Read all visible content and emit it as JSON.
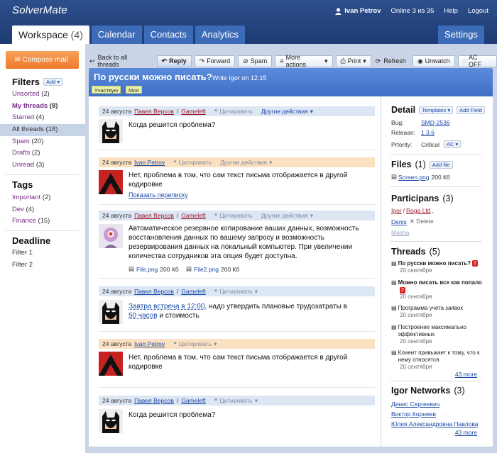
{
  "app": {
    "logo": "SolverMate"
  },
  "topbar": {
    "user": "Ivan Petrov",
    "online": "Online 3 из 35",
    "help": "Help",
    "logout": "Logout"
  },
  "tabs": [
    {
      "label": "Workspace",
      "count": "(4)"
    },
    {
      "label": "Calendar"
    },
    {
      "label": "Contacts"
    },
    {
      "label": "Analytics"
    }
  ],
  "settings": "Settings",
  "sidebar": {
    "compose": "Compose mail",
    "filters_title": "Filters",
    "add": "Add",
    "filters": [
      {
        "label": "Unsorted",
        "count": "(2)"
      },
      {
        "label": "My threads",
        "count": "(8)"
      },
      {
        "label": "Starred",
        "count": "(4)"
      },
      {
        "label": "All threads",
        "count": "(18)"
      },
      {
        "label": "Spam",
        "count": "(20)"
      },
      {
        "label": "Drafts",
        "count": "(2)"
      },
      {
        "label": "Unread",
        "count": "(3)"
      }
    ],
    "tags_title": "Tags",
    "tags": [
      {
        "label": "Important",
        "count": "(2)"
      },
      {
        "label": "Dev",
        "count": "(4)"
      },
      {
        "label": "Finance",
        "count": "(15)"
      }
    ],
    "deadline_title": "Deadline",
    "deadlines": [
      "Filter 1",
      "Filter 2"
    ]
  },
  "toolbar": {
    "back": "Back to all threads",
    "reply": "Reply",
    "forward": "Forward",
    "spam": "Spam",
    "more": "More actions",
    "print": "Print",
    "refresh": "Refresh",
    "unwatch": "Unwatch",
    "acoff": "AC OFF"
  },
  "subject": {
    "title": "По русски можно писать?",
    "write_prefix": "Write",
    "write_user": "Igor",
    "write_time": "on 12:15",
    "tags": [
      "Участвую",
      "Моя"
    ]
  },
  "messages": [
    {
      "date": "24 августа",
      "author": "Павел Версов",
      "company": "Gameleft",
      "quote": "Цитировать",
      "other": "Другие действия",
      "text": "Когда решится проблема?"
    },
    {
      "date": "24 августа",
      "author": "Ivan Petrov",
      "quote": "Цитировать",
      "other": "Другие действия",
      "text": "Нет, проблема в том, что сам текст письма отображается в другой кодировке",
      "link": "Показать переписку"
    },
    {
      "date": "24 августа",
      "author": "Павел Версов",
      "company": "Gameleft",
      "quote": "Цитировать",
      "other": "Другие действия",
      "text": "Автоматическое резервное копирование ваших данных, возможность восстановления данных по вашему запросу и возможность резервирования данных на локальный компьютер. При увеличении количества сотрудников эта опция будет доступна.",
      "attachments": [
        {
          "name": "File.png",
          "size": "200 Кб"
        },
        {
          "name": "File2.png",
          "size": "200 Кб"
        }
      ]
    },
    {
      "date": "24 августа",
      "author": "Павел Версов",
      "company": "Gameleft",
      "quote": "Цитировать",
      "text_link1": "Завтра встреча в 12:00",
      "text_mid": ", надо утвердить плановые трудозатраты в",
      "text_link2": "50 часов",
      "text_end": "и стоимость"
    },
    {
      "date": "24 августа",
      "author": "Ivan Petrov",
      "quote": "Цитировать",
      "text": "Нет, проблема в том, что сам текст письма отображается в другой кодировке"
    },
    {
      "date": "24 августа",
      "author": "Павел Версов",
      "company": "Gameleft",
      "quote": "Цитировать",
      "text": "Когда решится проблема?"
    }
  ],
  "detail": {
    "title": "Detail",
    "templates": "Templates",
    "add_field": "Add Field",
    "bug_label": "Bug:",
    "bug": "SMD-2536",
    "release_label": "Release:",
    "release": "1.3.6",
    "priority_label": "Prtority:",
    "priority": "Critical",
    "priority_ac": "AC"
  },
  "files": {
    "title": "Files",
    "count": "(1)",
    "add": "Add file",
    "file": "Screen.png",
    "size": "200 Кб"
  },
  "participants": {
    "title": "Participans",
    "count": "(3)",
    "p1": "Igor",
    "p1_company": "Roga Ltd",
    "p2": "Denis",
    "delete": "Delete",
    "p3": "Masha"
  },
  "threads": {
    "title": "Threads",
    "count": "(5)",
    "items": [
      {
        "title": "По русски можно писать?",
        "badge": "2",
        "date": "20 сентября",
        "bold": true
      },
      {
        "title": "Можно писать все как попало",
        "badge": "2",
        "date": "20 сентября",
        "bold": true
      },
      {
        "title": "Программа учета заявок",
        "date": "20 сентября"
      },
      {
        "title": "Построение максимально эффективных",
        "date": "20 сентября"
      },
      {
        "title": "Клиент привыкает к тому, что к нему относятся",
        "date": "20 сентября"
      }
    ],
    "more": "43 more"
  },
  "network": {
    "title": "Igor Networks",
    "count": "(3)",
    "people": [
      "Денис Сергеевич",
      "Виктор Корнеев",
      "Юлия Александровна Павлова"
    ],
    "more": "43 more"
  }
}
